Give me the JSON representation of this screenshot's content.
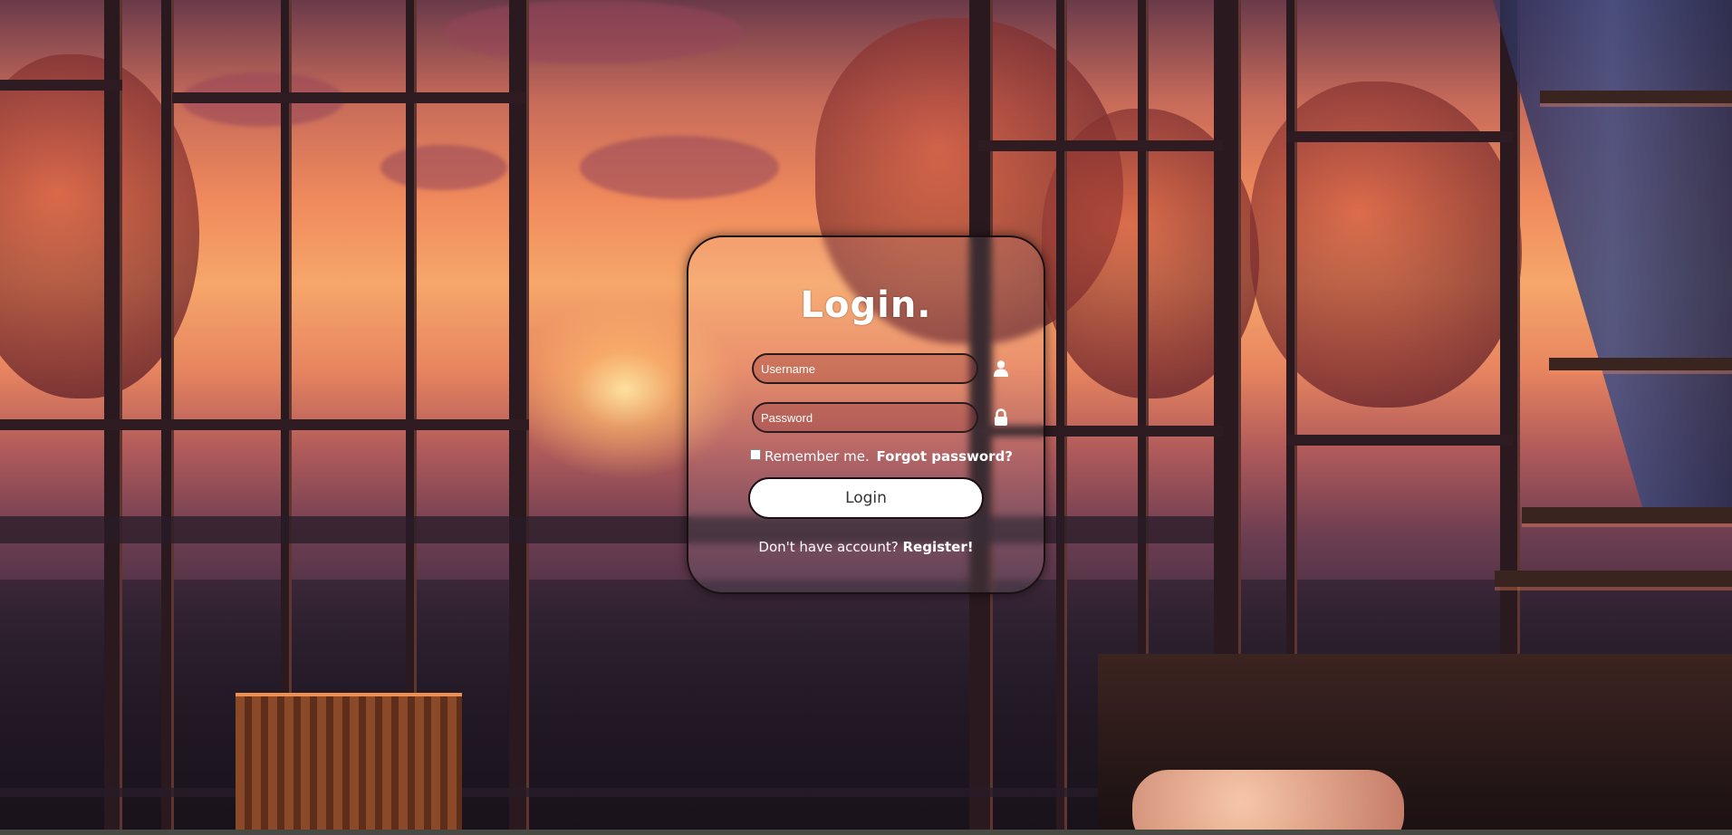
{
  "login": {
    "title": "Login.",
    "username_placeholder": "Username",
    "password_placeholder": "Password",
    "username_icon": "user-icon",
    "password_icon": "lock-icon",
    "remember_label": "Remember me.",
    "forgot_link": "Forgot password?",
    "login_button": "Login",
    "register_prompt": "Don't have account?",
    "register_link": "Register!"
  },
  "colors": {
    "card_border": "#1a1014",
    "button_bg": "#ffffff",
    "text": "#ffffff"
  }
}
